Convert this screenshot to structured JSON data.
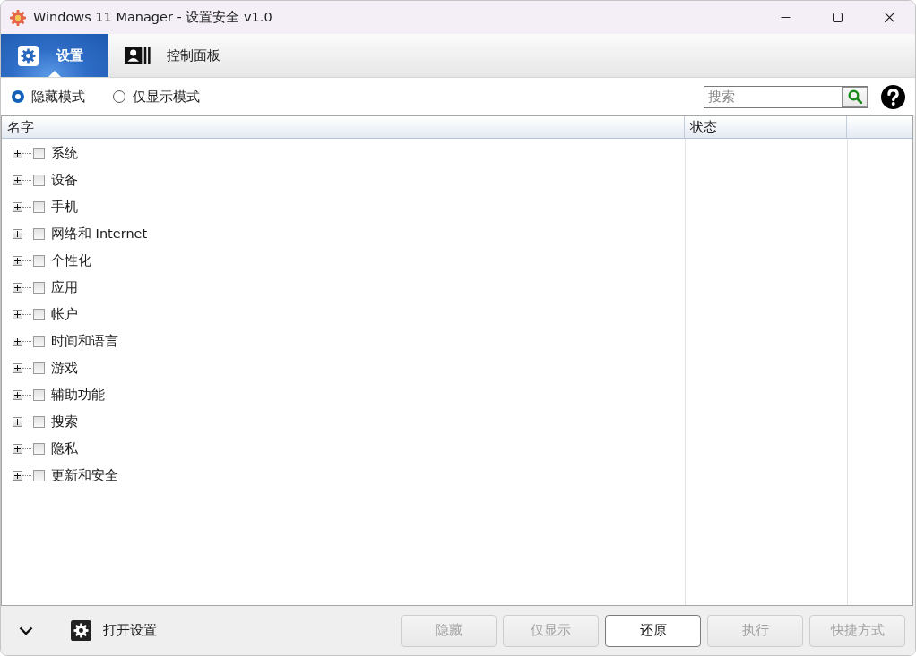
{
  "window": {
    "title": "Windows 11 Manager - 设置安全 v1.0"
  },
  "tabs": [
    {
      "label": "设置",
      "selected": true,
      "kind": "gear"
    },
    {
      "label": "控制面板",
      "selected": false,
      "kind": "card"
    }
  ],
  "mode_options": [
    {
      "label": "隐藏模式",
      "selected": true
    },
    {
      "label": "仅显示模式",
      "selected": false
    }
  ],
  "search": {
    "placeholder": "搜索"
  },
  "tree": {
    "columns": [
      "名字",
      "状态"
    ],
    "items": [
      {
        "label": "系统",
        "expanded": false,
        "checked": false
      },
      {
        "label": "设备",
        "expanded": false,
        "checked": false
      },
      {
        "label": "手机",
        "expanded": false,
        "checked": false
      },
      {
        "label": "网络和 Internet",
        "expanded": false,
        "checked": false
      },
      {
        "label": "个性化",
        "expanded": false,
        "checked": false
      },
      {
        "label": "应用",
        "expanded": false,
        "checked": false
      },
      {
        "label": "帐户",
        "expanded": false,
        "checked": false
      },
      {
        "label": "时间和语言",
        "expanded": false,
        "checked": false
      },
      {
        "label": "游戏",
        "expanded": false,
        "checked": false
      },
      {
        "label": "辅助功能",
        "expanded": false,
        "checked": false
      },
      {
        "label": "搜索",
        "expanded": false,
        "checked": false
      },
      {
        "label": "隐私",
        "expanded": false,
        "checked": false
      },
      {
        "label": "更新和安全",
        "expanded": false,
        "checked": false
      }
    ]
  },
  "footer": {
    "link": "打开设置",
    "buttons": [
      {
        "label": "隐藏",
        "disabled": true
      },
      {
        "label": "仅显示",
        "disabled": true
      },
      {
        "label": "还原",
        "disabled": false
      },
      {
        "label": "执行",
        "disabled": true
      },
      {
        "label": "快捷方式",
        "disabled": true
      }
    ]
  }
}
